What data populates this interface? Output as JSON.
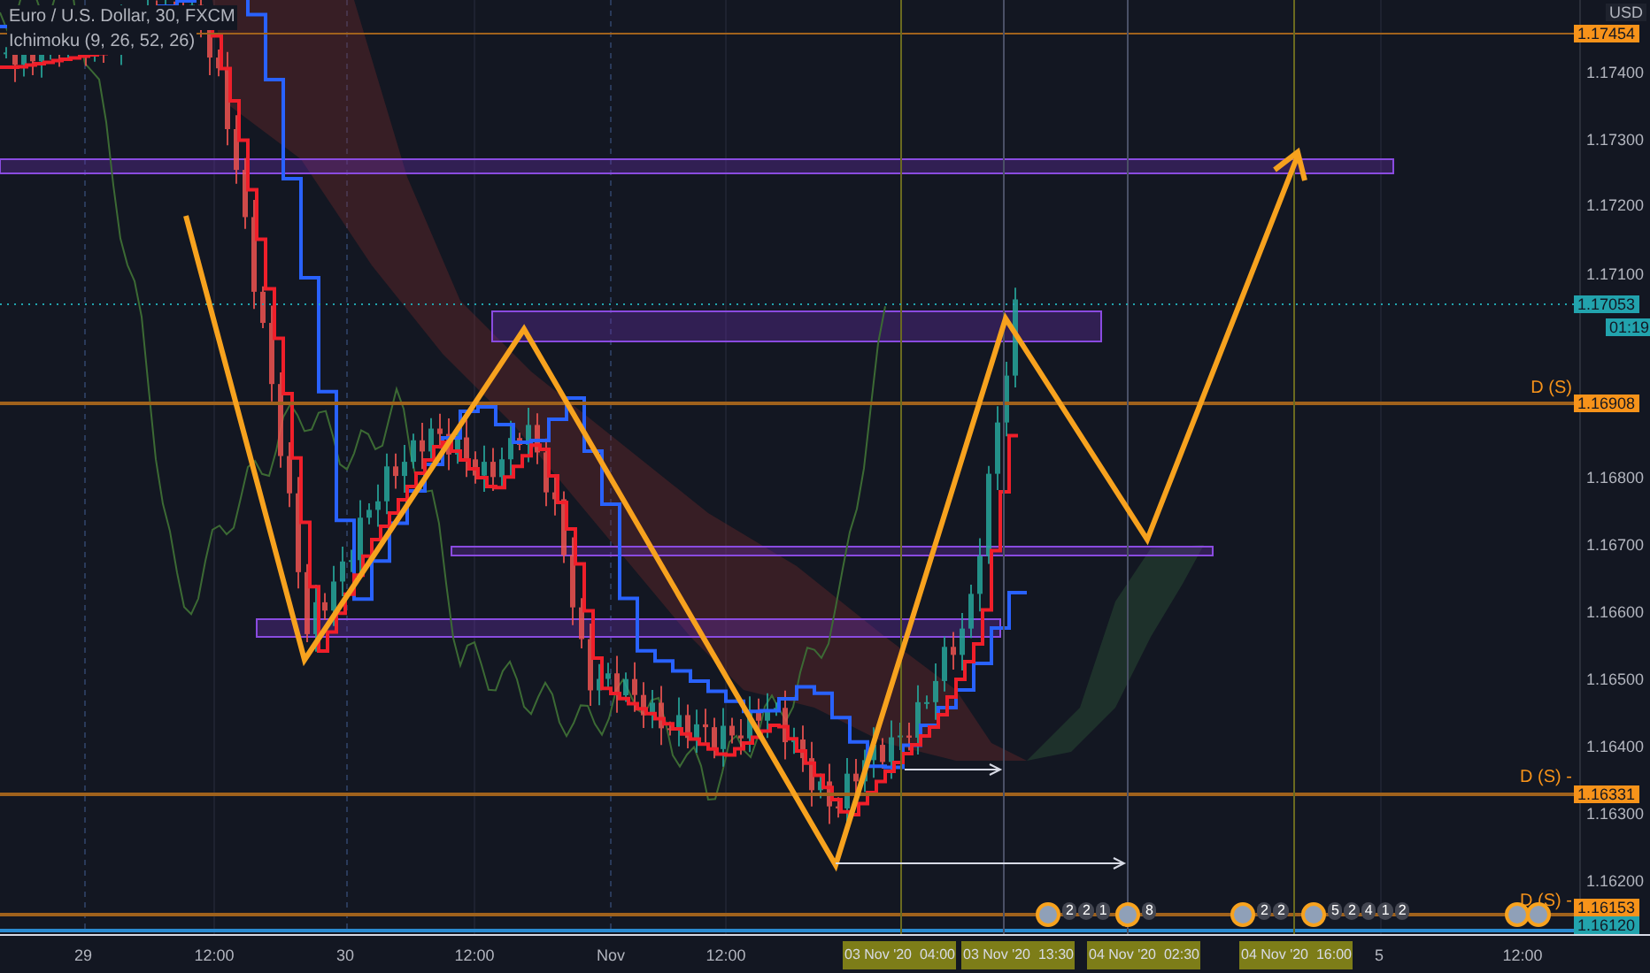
{
  "legend": {
    "symbol": "Euro / U.S. Dollar, 30, FXCM",
    "indicator": "Ichimoku (9, 26, 52, 26)"
  },
  "currency": "USD",
  "price_labels": [
    "1.17400",
    "1.17300",
    "1.17200",
    "1.17100",
    "1.16800",
    "1.16700",
    "1.16600",
    "1.16500",
    "1.16400",
    "1.16300",
    "1.16200"
  ],
  "price_badges": [
    {
      "text": "1.17454",
      "color": "#f7931a"
    },
    {
      "text": "1.17053",
      "color": "#22a3ad"
    },
    {
      "text": "01:19",
      "color": "#22a3ad"
    },
    {
      "text": "1.16908",
      "color": "#f7931a"
    },
    {
      "text": "1.16331",
      "color": "#f7931a"
    },
    {
      "text": "1.16153",
      "color": "#f7931a"
    },
    {
      "text": "1.16120",
      "color": "#22a3ad"
    }
  ],
  "line_labels": [
    "D (S)",
    "D (S) -",
    "D (S) -"
  ],
  "time_labels": [
    {
      "text": "29",
      "highlighted": false
    },
    {
      "text": "12:00",
      "highlighted": false
    },
    {
      "text": "30",
      "highlighted": false
    },
    {
      "text": "12:00",
      "highlighted": false
    },
    {
      "text": "Nov",
      "highlighted": false
    },
    {
      "text": "12:00",
      "highlighted": false
    },
    {
      "text": "03 Nov '20  04:00",
      "highlighted": true
    },
    {
      "text": "03 Nov '20  13:30",
      "highlighted": true
    },
    {
      "text": "04 Nov '20  02:30",
      "highlighted": true
    },
    {
      "text": "04 Nov '20  16:00",
      "highlighted": true
    },
    {
      "text": "5",
      "highlighted": false
    },
    {
      "text": "12:00",
      "highlighted": false
    }
  ],
  "events": [
    {
      "kind": "flag",
      "counts": [
        "2",
        "2",
        "1"
      ]
    },
    {
      "kind": "flag",
      "counts": [
        "8"
      ]
    },
    {
      "kind": "flag",
      "counts": [
        "2",
        "2"
      ]
    },
    {
      "kind": "flag",
      "counts": [
        "5",
        "2",
        "4",
        "1",
        "2"
      ]
    },
    {
      "kind": "flag"
    },
    {
      "kind": "flag"
    }
  ]
}
